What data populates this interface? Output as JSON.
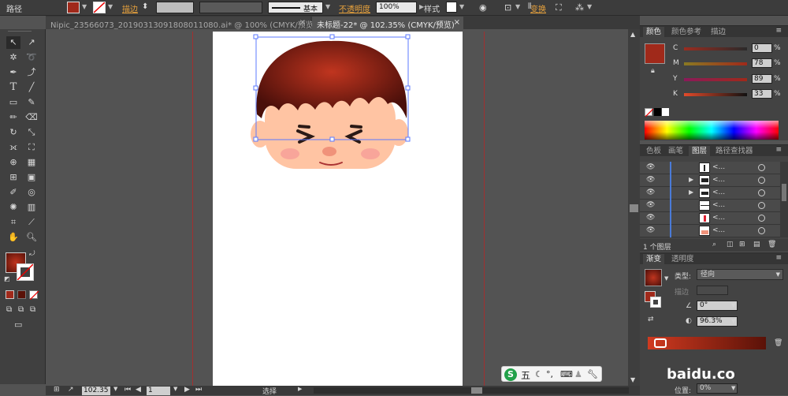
{
  "control_bar": {
    "object_type": "路径",
    "stroke_label": "描边",
    "stroke_style": "基本",
    "opacity_label": "不透明度",
    "opacity_value": "100%",
    "style_label": "样式",
    "transform_label": "变换"
  },
  "tabs": [
    {
      "label": "Nipic_23566073_20190313091808011080.ai* @ 100% (CMYK/预览)"
    },
    {
      "label": "未标题-22* @ 102.35% (CMYK/预览)"
    }
  ],
  "color_panel": {
    "tabs": [
      "颜色",
      "颜色参考",
      "描边"
    ],
    "sliders": [
      {
        "label": "C",
        "value": "0"
      },
      {
        "label": "M",
        "value": "78"
      },
      {
        "label": "Y",
        "value": "89"
      },
      {
        "label": "K",
        "value": "33"
      }
    ],
    "percent": "%"
  },
  "layers_panel": {
    "tabs": [
      "色板",
      "画笔",
      "图层",
      "路径查找器"
    ],
    "rows": [
      {
        "name": "<..."
      },
      {
        "name": "<..."
      },
      {
        "name": "<..."
      },
      {
        "name": "<..."
      },
      {
        "name": "<..."
      },
      {
        "name": "<..."
      }
    ],
    "footer": "1 个图层"
  },
  "gradient_panel": {
    "tabs": [
      "渐变",
      "透明度"
    ],
    "type_label": "类型:",
    "type_value": "径向",
    "stroke_label": "描边",
    "angle_value": "0°",
    "aspect_value": "96.3%",
    "position_label": "位置:",
    "position_value": "0%"
  },
  "status_bar": {
    "zoom": "102.35",
    "page": "1",
    "tool": "选择"
  },
  "ime": {
    "label": "五"
  },
  "watermark": {
    "text": "baidu.co"
  },
  "colors": {
    "fill": "#a0291a",
    "hair_dark": "#4a0f0a",
    "skin": "#ffc4a3"
  }
}
